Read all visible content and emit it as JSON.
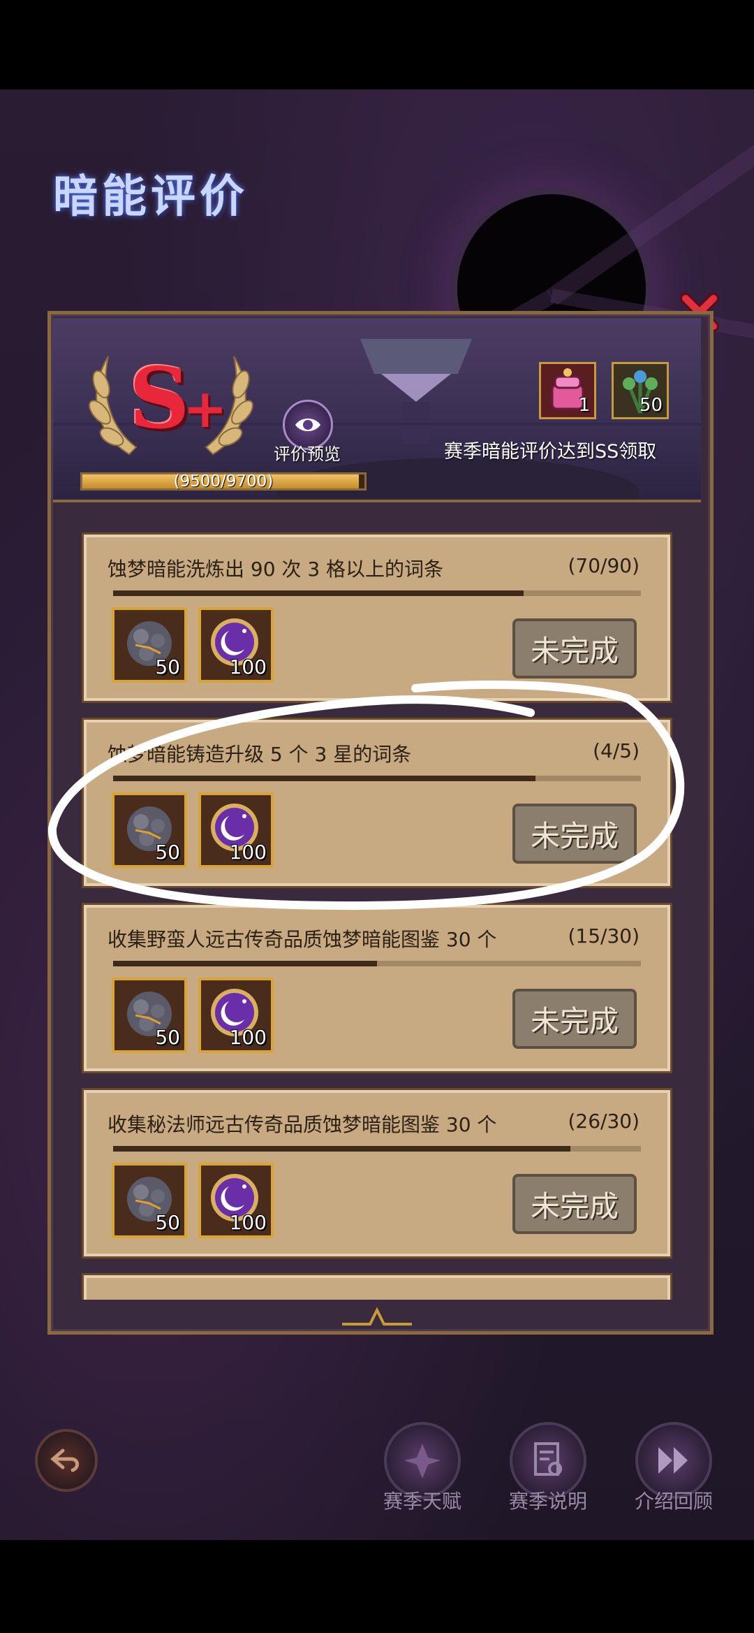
{
  "title": "暗能评价",
  "rating": {
    "grade": "S",
    "plus": "+",
    "progress_text": "(9500/9700)",
    "progress_fraction": 0.979
  },
  "preview": {
    "label": "评价预览",
    "icon": "eye-icon"
  },
  "season_reward": {
    "text": "赛季暗能评价达到SS领取",
    "items": [
      {
        "icon": "pink-chest-icon",
        "count": "1"
      },
      {
        "icon": "herb-bouquet-icon",
        "count": "50"
      }
    ]
  },
  "tasks": [
    {
      "title": "蚀梦暗能洗炼出 90 次 3 格以上的词条",
      "count": "(70/90)",
      "progress": 0.778,
      "rewards": [
        {
          "icon": "ore-stone-icon",
          "count": "50"
        },
        {
          "icon": "moon-orb-icon",
          "count": "100"
        }
      ],
      "status": "未完成"
    },
    {
      "title": "蚀梦暗能铸造升级 5 个 3 星的词条",
      "count": "(4/5)",
      "progress": 0.8,
      "rewards": [
        {
          "icon": "ore-stone-icon",
          "count": "50"
        },
        {
          "icon": "moon-orb-icon",
          "count": "100"
        }
      ],
      "status": "未完成"
    },
    {
      "title": "收集野蛮人远古传奇品质蚀梦暗能图鉴 30 个",
      "count": "(15/30)",
      "progress": 0.5,
      "rewards": [
        {
          "icon": "ore-stone-icon",
          "count": "50"
        },
        {
          "icon": "moon-orb-icon",
          "count": "100"
        }
      ],
      "status": "未完成"
    },
    {
      "title": "收集秘法师远古传奇品质蚀梦暗能图鉴 30 个",
      "count": "(26/30)",
      "progress": 0.867,
      "rewards": [
        {
          "icon": "ore-stone-icon",
          "count": "50"
        },
        {
          "icon": "moon-orb-icon",
          "count": "100"
        }
      ],
      "status": "未完成"
    }
  ],
  "nav": [
    {
      "label": "赛季天赋",
      "icon": "talent-icon"
    },
    {
      "label": "赛季说明",
      "icon": "document-icon"
    },
    {
      "label": "介绍回顾",
      "icon": "fast-forward-icon"
    }
  ],
  "colors": {
    "accent_gold": "#c79a3a",
    "grade_red": "#e8283a",
    "card_bg": "#c7a982",
    "status_btn": "#8c7e6c"
  }
}
